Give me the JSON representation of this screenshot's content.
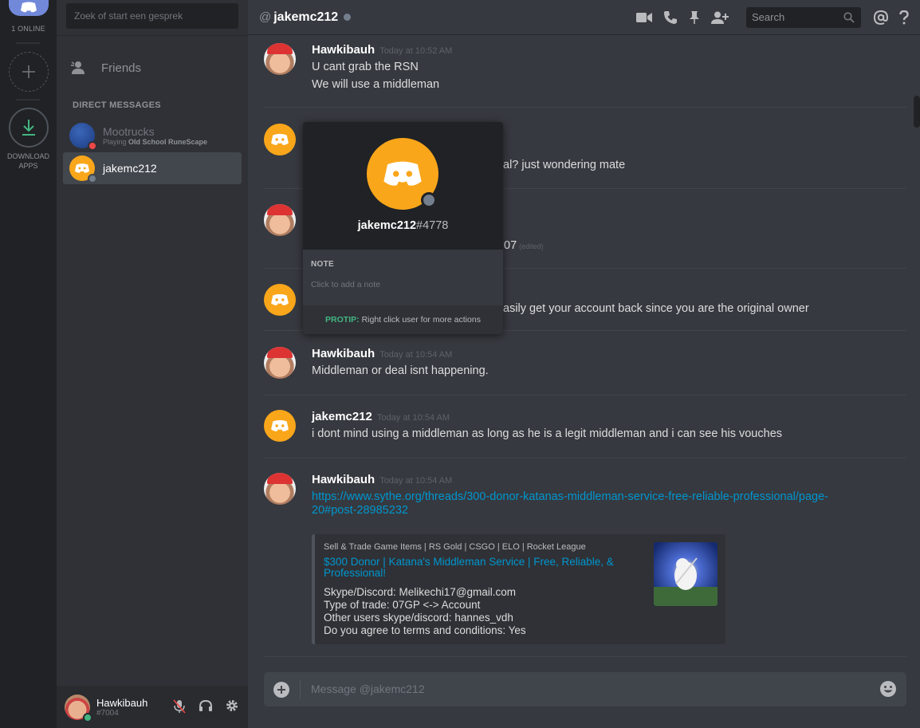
{
  "rail": {
    "online_count": "1 ONLINE",
    "download_label_line1": "DOWNLOAD",
    "download_label_line2": "APPS"
  },
  "sidebar": {
    "search_placeholder": "Zoek of start een gesprek",
    "friends_label": "Friends",
    "dm_header": "DIRECT MESSAGES",
    "dms": [
      {
        "name": "Mootrucks",
        "status_prefix": "Playing",
        "status_game": "Old School RuneScape",
        "status_color": "#f04747"
      },
      {
        "name": "jakemc212",
        "status_color": "#747f8d"
      }
    ]
  },
  "user_panel": {
    "name": "Hawkibauh",
    "tag": "#7004",
    "status_color": "#43b581"
  },
  "header": {
    "at": "@",
    "title": "jakemc212",
    "search_placeholder": "Search"
  },
  "messages": [
    {
      "author": "Hawkibauh",
      "time": "Today at 10:52 AM",
      "lines": [
        "U cant grab the RSN",
        "We will use a middleman"
      ]
    },
    {
      "author": "jakemc212",
      "visible_text": "al? just wondering mate"
    },
    {
      "author": "Hawkibauh",
      "visible_text": "07",
      "edited": "(edited)"
    },
    {
      "author": "jakemc212",
      "visible_text": "asily get your account back since you are the original owner"
    },
    {
      "author": "Hawkibauh",
      "time": "Today at 10:54 AM",
      "lines": [
        "Middleman or deal isnt happening."
      ]
    },
    {
      "author": "jakemc212",
      "time": "Today at 10:54 AM",
      "lines": [
        "i dont mind using a middleman as long as he is a legit middleman and i can see his vouches"
      ]
    },
    {
      "author": "Hawkibauh",
      "time": "Today at 10:54 AM",
      "link_line1": "https://www.sythe.org/threads/300-donor-katanas-middleman-service-free-reliable-professional/page-",
      "link_line2": "20#post-28985232",
      "embed": {
        "provider": "Sell & Trade Game Items | RS Gold | CSGO | ELO | Rocket League",
        "title": "$300 Donor | Katana's Middleman Service | Free, Reliable, & Professional!",
        "desc": [
          "Skype/Discord: Melikechi17@gmail.com",
          "Type of trade: 07GP <-> Account",
          "Other users skype/discord: hannes_vdh",
          "Do you agree to terms and conditions: Yes"
        ]
      }
    }
  ],
  "composer": {
    "placeholder": "Message @jakemc212"
  },
  "popout": {
    "username": "jakemc212",
    "discriminator": "#4778",
    "note_label": "NOTE",
    "note_placeholder": "Click to add a note",
    "protip_label": "PROTIP:",
    "protip_text": "Right click user for more actions"
  },
  "colors": {
    "discord_orange": "#faa61a",
    "blurple": "#7289da",
    "link": "#0096cf",
    "online": "#43b581",
    "dnd": "#f04747",
    "offline": "#747f8d"
  }
}
